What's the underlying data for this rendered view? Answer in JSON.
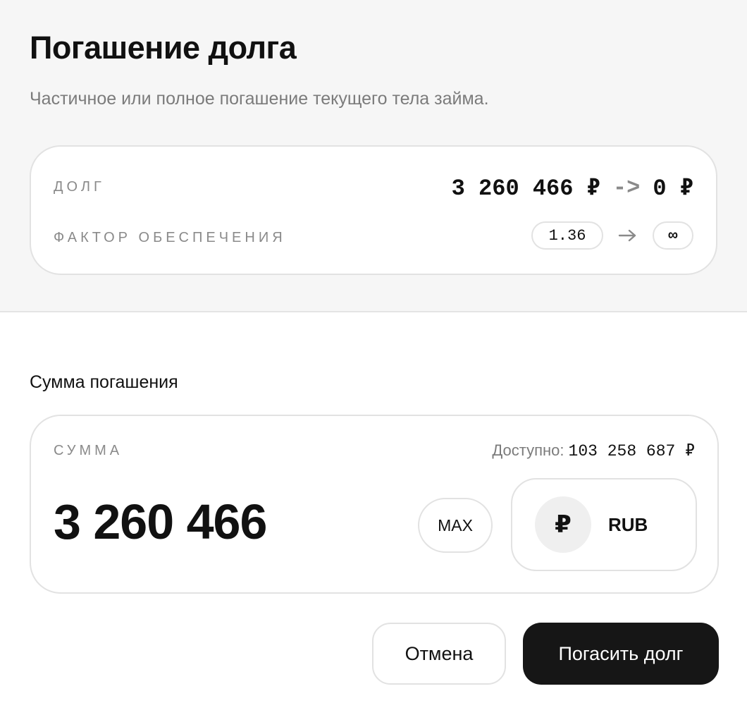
{
  "header": {
    "title": "Погашение долга",
    "subtitle": "Частичное или полное погашение текущего тела займа."
  },
  "summary": {
    "debt_label": "ДОЛГ",
    "debt_current": "3 260 466 ₽",
    "debt_arrow": "->",
    "debt_after": "0 ₽",
    "factor_label": "ФАКТОР ОБЕСПЕЧЕНИЯ",
    "factor_current": "1.36",
    "factor_after": "∞"
  },
  "repayment": {
    "section_label": "Сумма погашения",
    "amount_label": "СУММА",
    "available_label": "Доступно:",
    "available_value": "103 258 687 ₽",
    "amount_value": "3 260 466",
    "max_label": "MAX",
    "currency_symbol": "₽",
    "currency_code": "RUB"
  },
  "actions": {
    "cancel_label": "Отмена",
    "submit_label": "Погасить долг"
  },
  "icons": {
    "factor_arrow": "arrow-right-icon",
    "currency": "ruble-icon"
  },
  "colors": {
    "primary_button": "#161616",
    "muted_text": "#7b7b7b",
    "header_bg": "#f6f6f6"
  }
}
